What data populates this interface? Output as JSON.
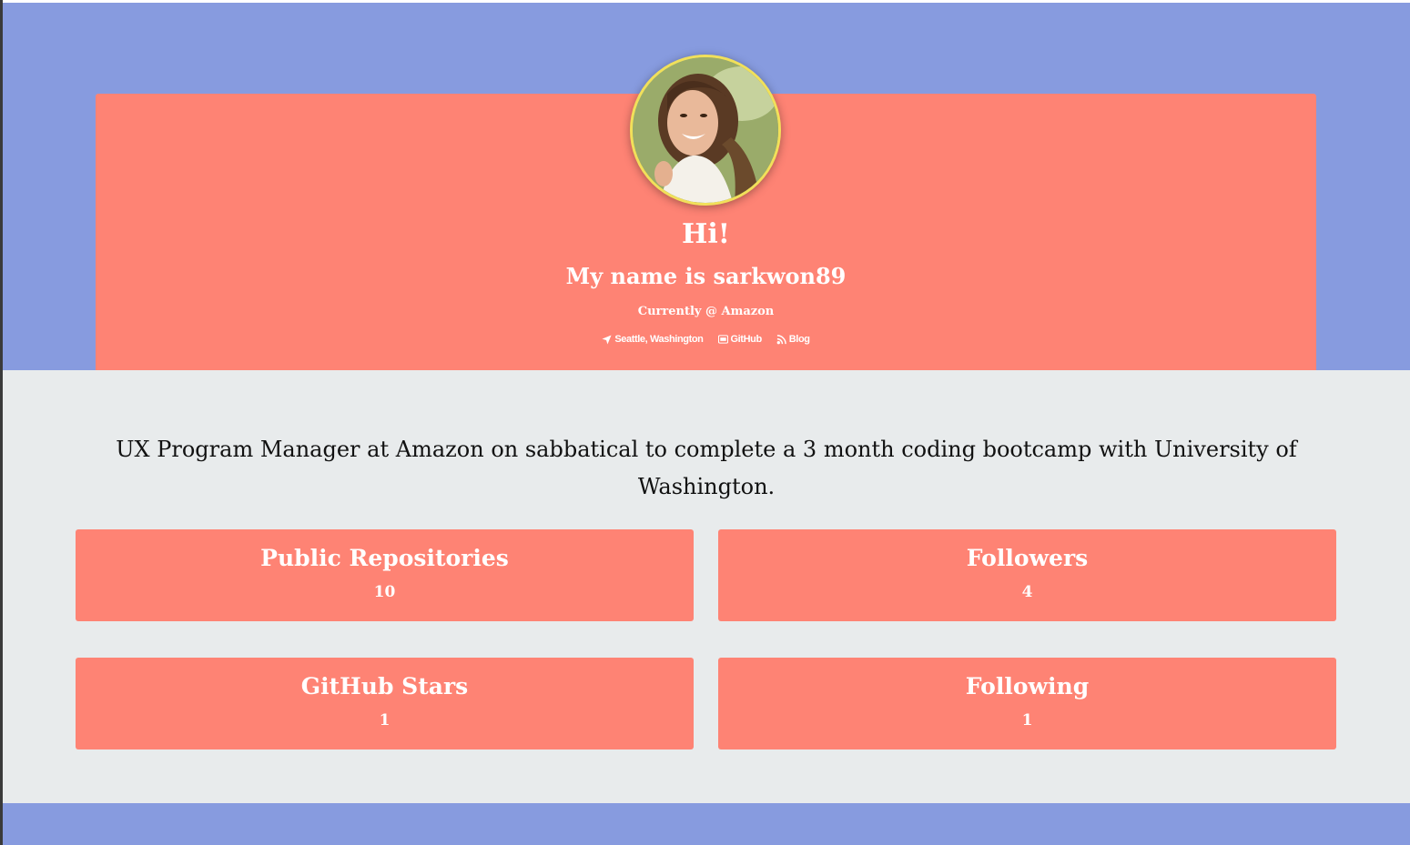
{
  "colors": {
    "band": "#879bdf",
    "card": "#fe8374",
    "avatar_ring": "#f1e05a",
    "content_bg": "#e8ebec",
    "text_light": "#ffffff",
    "text_dark": "#111111"
  },
  "hero": {
    "greeting": "Hi!",
    "name_line": "My name is sarkwon89",
    "company_line": "Currently @ Amazon",
    "links": [
      {
        "icon": "location-arrow-icon",
        "label": "Seattle, Washington"
      },
      {
        "icon": "github-icon",
        "label": "GitHub"
      },
      {
        "icon": "rss-icon",
        "label": "Blog"
      }
    ]
  },
  "bio": "UX Program Manager at Amazon on sabbatical to complete a 3 month coding bootcamp with University of Washington.",
  "stats": [
    {
      "label": "Public Repositories",
      "value": "10"
    },
    {
      "label": "Followers",
      "value": "4"
    },
    {
      "label": "GitHub Stars",
      "value": "1"
    },
    {
      "label": "Following",
      "value": "1"
    }
  ]
}
